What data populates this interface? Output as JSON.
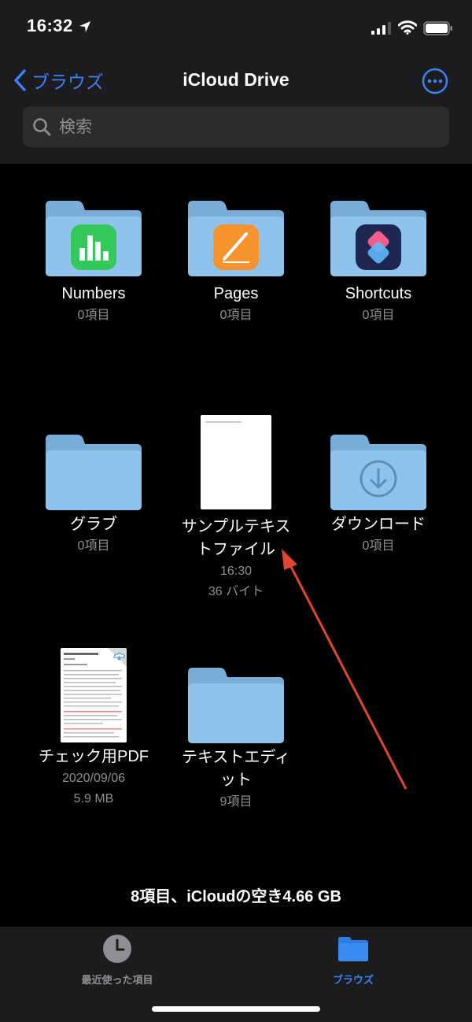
{
  "status": {
    "time": "16:32"
  },
  "nav": {
    "back_label": "ブラウズ",
    "title": "iCloud Drive"
  },
  "search": {
    "placeholder": "検索"
  },
  "items": [
    {
      "name": "Numbers",
      "meta1": "0項目"
    },
    {
      "name": "Pages",
      "meta1": "0項目"
    },
    {
      "name": "Shortcuts",
      "meta1": "0項目"
    },
    {
      "name": "グラブ",
      "meta1": "0項目"
    },
    {
      "name_line1": "サンプルテキス",
      "name_line2": "トファイル",
      "meta1": "16:30",
      "meta2": "36 バイト"
    },
    {
      "name": "ダウンロード",
      "meta1": "0項目"
    },
    {
      "name": "チェック用PDF",
      "meta1": "2020/09/06",
      "meta2": "5.9 MB"
    },
    {
      "name_line1": "テキストエディ",
      "name_line2": "ット",
      "meta1": "9項目"
    }
  ],
  "summary": "8項目、iCloudの空き4.66 GB",
  "tabs": [
    {
      "label": "最近使った項目",
      "state": "inactive"
    },
    {
      "label": "ブラウズ",
      "state": "active"
    }
  ],
  "colors": {
    "accent": "#3b82f6",
    "folder": "#8fc3ec",
    "header_bg": "#1c1c1e",
    "annotation_arrow": "#e0452f"
  }
}
